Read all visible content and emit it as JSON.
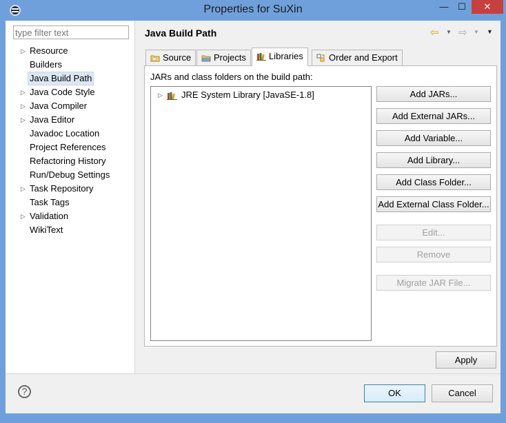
{
  "window": {
    "title": "Properties for SuXin"
  },
  "titlebar": {
    "min": "—",
    "max": "☐",
    "close": "✕"
  },
  "left": {
    "filter_placeholder": "type filter text",
    "items": [
      {
        "label": "Resource",
        "expandable": true
      },
      {
        "label": "Builders",
        "expandable": false
      },
      {
        "label": "Java Build Path",
        "expandable": false,
        "selected": true
      },
      {
        "label": "Java Code Style",
        "expandable": true
      },
      {
        "label": "Java Compiler",
        "expandable": true
      },
      {
        "label": "Java Editor",
        "expandable": true
      },
      {
        "label": "Javadoc Location",
        "expandable": false
      },
      {
        "label": "Project References",
        "expandable": false
      },
      {
        "label": "Refactoring History",
        "expandable": false
      },
      {
        "label": "Run/Debug Settings",
        "expandable": false
      },
      {
        "label": "Task Repository",
        "expandable": true
      },
      {
        "label": "Task Tags",
        "expandable": false
      },
      {
        "label": "Validation",
        "expandable": true
      },
      {
        "label": "WikiText",
        "expandable": false
      }
    ]
  },
  "page": {
    "title": "Java Build Path"
  },
  "tabs": [
    {
      "label": "Source",
      "icon": "source-folder-icon"
    },
    {
      "label": "Projects",
      "icon": "projects-folder-icon"
    },
    {
      "label": "Libraries",
      "icon": "libraries-icon",
      "active": true
    },
    {
      "label": "Order and Export",
      "icon": "order-export-icon"
    }
  ],
  "panel": {
    "label": "JARs and class folders on the build path:",
    "libraries": [
      {
        "label": "JRE System Library [JavaSE-1.8]"
      }
    ]
  },
  "buttons": {
    "add_jars": "Add JARs...",
    "add_external_jars": "Add External JARs...",
    "add_variable": "Add Variable...",
    "add_library": "Add Library...",
    "add_class_folder": "Add Class Folder...",
    "add_external_class_folder": "Add External Class Folder...",
    "edit": "Edit...",
    "remove": "Remove",
    "migrate_jar": "Migrate JAR File...",
    "apply": "Apply",
    "ok": "OK",
    "cancel": "Cancel",
    "help": "?"
  },
  "colors": {
    "window_frame": "#6fa0dc",
    "selection_bg": "#dde7f4",
    "ok_border": "#3c7fb1"
  }
}
